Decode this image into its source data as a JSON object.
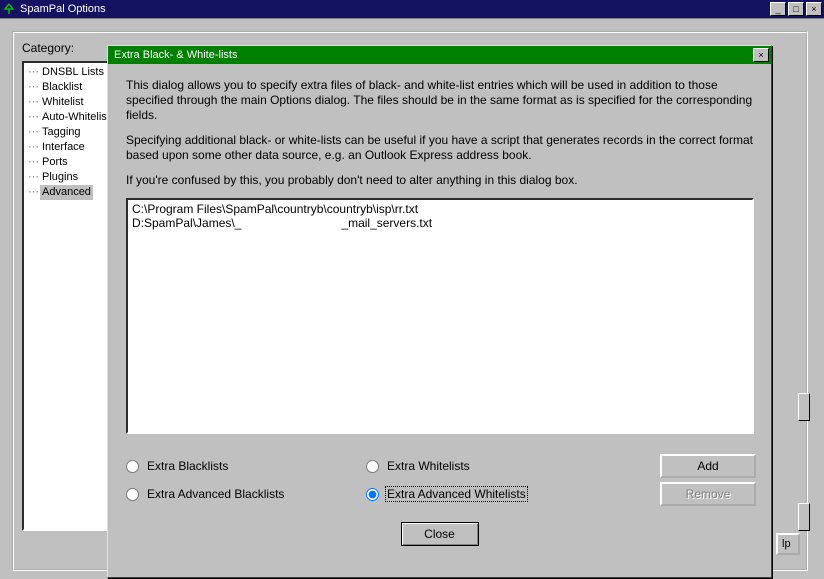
{
  "mainWindow": {
    "title": "SpamPal Options",
    "category_label": "Category:",
    "help_peek": "lp",
    "tree": [
      {
        "label": "DNSBL Lists",
        "selected": false
      },
      {
        "label": "Blacklist",
        "selected": false
      },
      {
        "label": "Whitelist",
        "selected": false
      },
      {
        "label": "Auto-Whitelist",
        "selected": false
      },
      {
        "label": "Tagging",
        "selected": false
      },
      {
        "label": "Interface",
        "selected": false
      },
      {
        "label": "Ports",
        "selected": false
      },
      {
        "label": "Plugins",
        "selected": false
      },
      {
        "label": "Advanced",
        "selected": true
      }
    ]
  },
  "dialog": {
    "title": "Extra Black- & White-lists",
    "desc1": "This dialog allows you to specify extra files of black- and white-list entries which will be used in addition to those specified through the main Options dialog.  The files should be in the same format as is specified for the corresponding fields.",
    "desc2": "Specifying additional black- or white-lists can be useful if you have a script that generates records in the correct format based upon some other data source, e.g. an Outlook Express address book.",
    "desc3": "If you're confused by this, you probably don't need to alter anything in this dialog box.",
    "list_items": [
      "C:\\Program Files\\SpamPal\\countryb\\countryb\\isp\\rr.txt",
      "D:SpamPal\\James\\_                              _mail_servers.txt"
    ],
    "radios": {
      "extra_blacklists": "Extra Blacklists",
      "extra_whitelists": "Extra Whitelists",
      "extra_adv_blacklists": "Extra Advanced Blacklists",
      "extra_adv_whitelists": "Extra Advanced Whitelists"
    },
    "buttons": {
      "add": "Add",
      "remove": "Remove",
      "close": "Close"
    },
    "selected_radio": "extra_adv_whitelists",
    "remove_enabled": false
  }
}
